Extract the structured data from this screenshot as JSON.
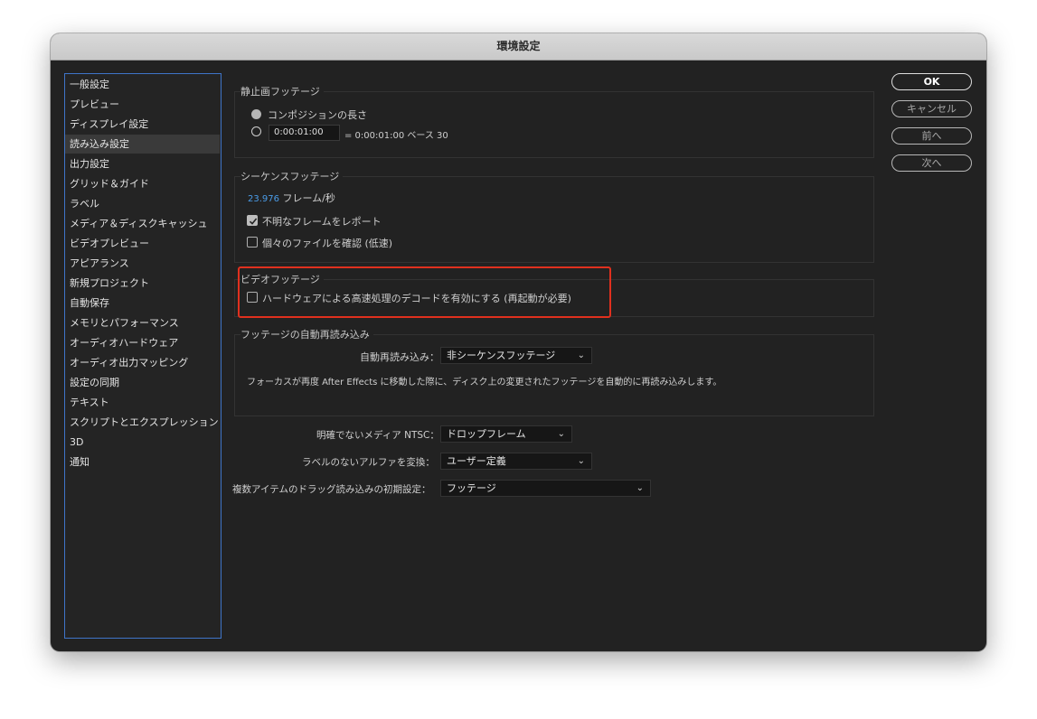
{
  "window": {
    "title": "環境設定"
  },
  "sidebar": {
    "items": [
      {
        "label": "一般設定"
      },
      {
        "label": "プレビュー"
      },
      {
        "label": "ディスプレイ設定"
      },
      {
        "label": "読み込み設定",
        "selected": true
      },
      {
        "label": "出力設定"
      },
      {
        "label": "グリッド＆ガイド"
      },
      {
        "label": "ラベル"
      },
      {
        "label": "メディア＆ディスクキャッシュ"
      },
      {
        "label": "ビデオプレビュー"
      },
      {
        "label": "アピアランス"
      },
      {
        "label": "新規プロジェクト"
      },
      {
        "label": "自動保存"
      },
      {
        "label": "メモリとパフォーマンス"
      },
      {
        "label": "オーディオハードウェア"
      },
      {
        "label": "オーディオ出力マッピング"
      },
      {
        "label": "設定の同期"
      },
      {
        "label": "テキスト"
      },
      {
        "label": "スクリプトとエクスプレッション"
      },
      {
        "label": "3D"
      },
      {
        "label": "通知"
      }
    ]
  },
  "buttons": {
    "ok": "OK",
    "cancel": "キャンセル",
    "prev": "前へ",
    "next": "次へ"
  },
  "still_footage": {
    "title": "静止画フッテージ",
    "option_comp_length": "コンポジションの長さ",
    "duration_value": "0:00:01:00",
    "duration_equals": "= 0:00:01:00 ベース 30"
  },
  "sequence_footage": {
    "title": "シーケンスフッテージ",
    "fps_value": "23.976",
    "fps_unit": "フレーム/秒",
    "report_missing_label": "不明なフレームをレポート",
    "report_missing_checked": true,
    "verify_files_label": "個々のファイルを確認 (低速)",
    "verify_files_checked": false
  },
  "video_footage": {
    "title": "ビデオフッテージ",
    "hw_decode_label": "ハードウェアによる高速処理のデコードを有効にする (再起動が必要)",
    "hw_decode_checked": false
  },
  "auto_reload": {
    "title": "フッテージの自動再読み込み",
    "label": "自動再読み込み：",
    "value": "非シーケンスフッテージ",
    "description": "フォーカスが再度 After Effects に移動した際に、ディスク上の変更されたフッテージを自動的に再読み込みします。"
  },
  "ntsc": {
    "label": "明確でないメディア NTSC：",
    "value": "ドロップフレーム"
  },
  "alpha": {
    "label": "ラベルのないアルファを変換：",
    "value": "ユーザー定義"
  },
  "drag_import": {
    "label": "複数アイテムのドラッグ読み込みの初期設定：",
    "value": "フッテージ"
  },
  "colors": {
    "accent_link": "#4a9ce8",
    "highlight_box": "#e0301e",
    "sidebar_border": "#3f74c9"
  }
}
